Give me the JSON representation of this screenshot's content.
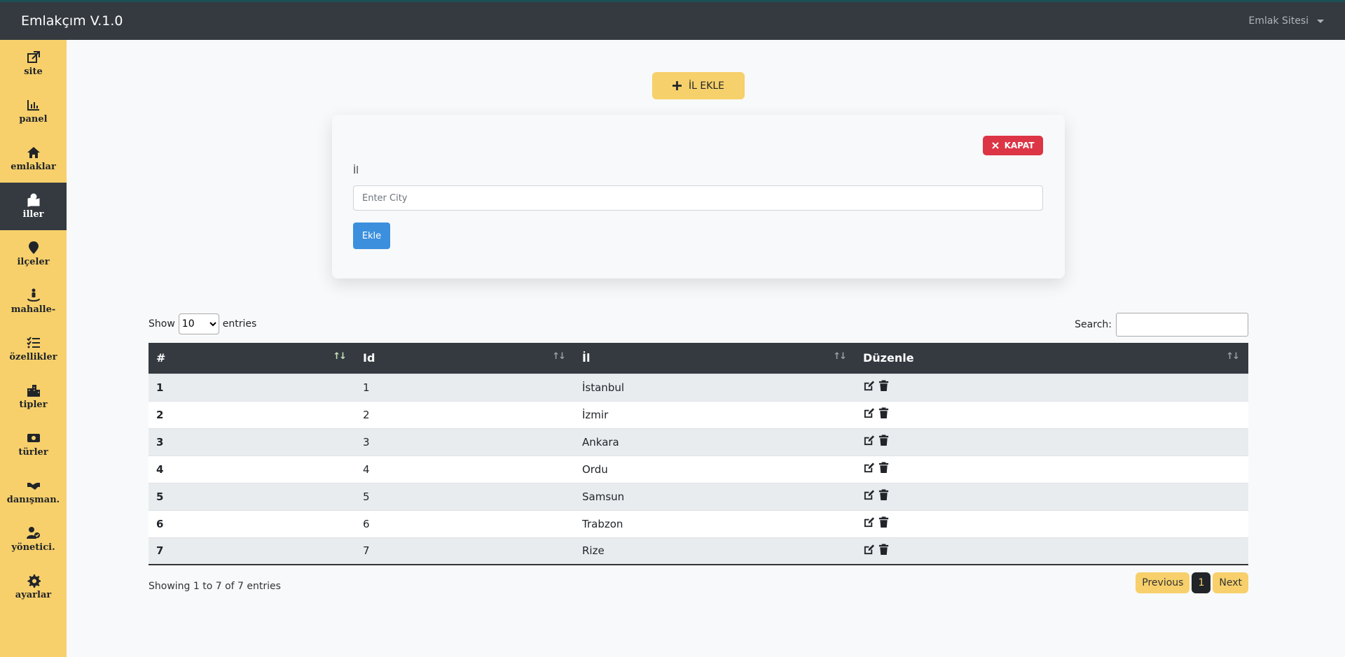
{
  "navbar": {
    "brand": "Emlakçım V.1.0",
    "right_menu": "Emlak Sitesi"
  },
  "sidebar": {
    "items": [
      {
        "label": "site",
        "icon": "external-link-icon"
      },
      {
        "label": "panel",
        "icon": "bar-chart-icon"
      },
      {
        "label": "emlaklar",
        "icon": "home-icon"
      },
      {
        "label": "iller",
        "icon": "map-marked-icon",
        "active": true
      },
      {
        "label": "ilçeler",
        "icon": "map-pin-icon"
      },
      {
        "label": "mahalle-",
        "icon": "street-view-icon"
      },
      {
        "label": "özellikler",
        "icon": "list-check-icon"
      },
      {
        "label": "tipler",
        "icon": "city-icon"
      },
      {
        "label": "türler",
        "icon": "money-bill-icon"
      },
      {
        "label": "danışman.",
        "icon": "handshake-icon"
      },
      {
        "label": "yönetici.",
        "icon": "user-check-icon"
      },
      {
        "label": "ayarlar",
        "icon": "gear-icon"
      }
    ]
  },
  "add_button": {
    "label": "İL EKLE"
  },
  "form": {
    "close_label": "KAPAT",
    "field_label": "İl",
    "placeholder": "Enter City",
    "value": "",
    "submit_label": "Ekle"
  },
  "table_controls": {
    "show_label": "Show",
    "entries_value": "10",
    "entries_label": "entries",
    "search_label": "Search:"
  },
  "table": {
    "headers": [
      "#",
      "Id",
      "İl",
      "Düzenle"
    ],
    "rows": [
      {
        "n": "1",
        "id": "1",
        "il": "İstanbul"
      },
      {
        "n": "2",
        "id": "2",
        "il": "İzmir"
      },
      {
        "n": "3",
        "id": "3",
        "il": "Ankara"
      },
      {
        "n": "4",
        "id": "4",
        "il": "Ordu"
      },
      {
        "n": "5",
        "id": "5",
        "il": "Samsun"
      },
      {
        "n": "6",
        "id": "6",
        "il": "Trabzon"
      },
      {
        "n": "7",
        "id": "7",
        "il": "Rize"
      }
    ]
  },
  "footer": {
    "info": "Showing 1 to 7 of 7 entries",
    "previous": "Previous",
    "current_page": "1",
    "next": "Next"
  },
  "colors": {
    "navbar": "#343a40",
    "sidebar": "#f7d06b",
    "accent_yellow": "#f6d06b",
    "danger": "#dc3545",
    "primary": "#3b8fdd"
  }
}
